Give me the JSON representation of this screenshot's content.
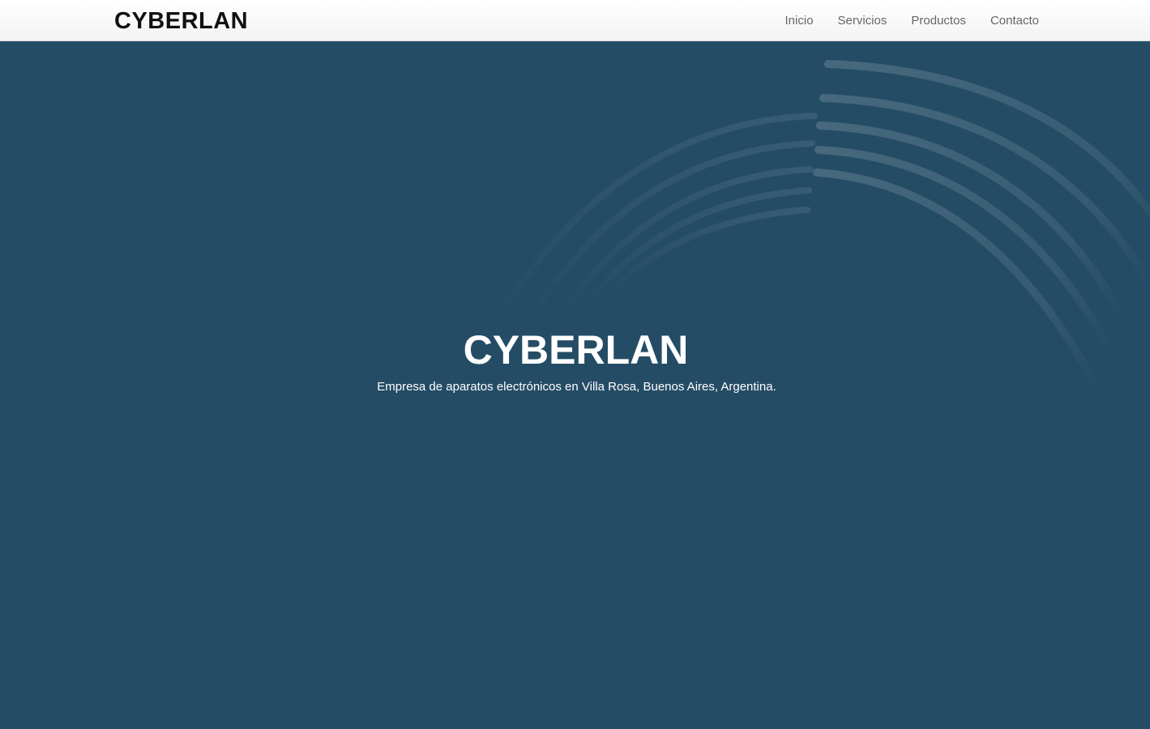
{
  "navbar": {
    "brand": "CYBERLAN",
    "links": [
      {
        "label": "Inicio"
      },
      {
        "label": "Servicios"
      },
      {
        "label": "Productos"
      },
      {
        "label": "Contacto"
      }
    ]
  },
  "hero": {
    "title": "CYBERLAN",
    "subtitle": "Empresa de aparatos electrónicos en Villa Rosa, Buenos Aires, Argentina."
  },
  "colors": {
    "hero_background": "#244c65",
    "navbar_background": "#ffffff",
    "brand_text": "#111111",
    "nav_link_text": "#666666",
    "hero_text": "#ffffff"
  }
}
